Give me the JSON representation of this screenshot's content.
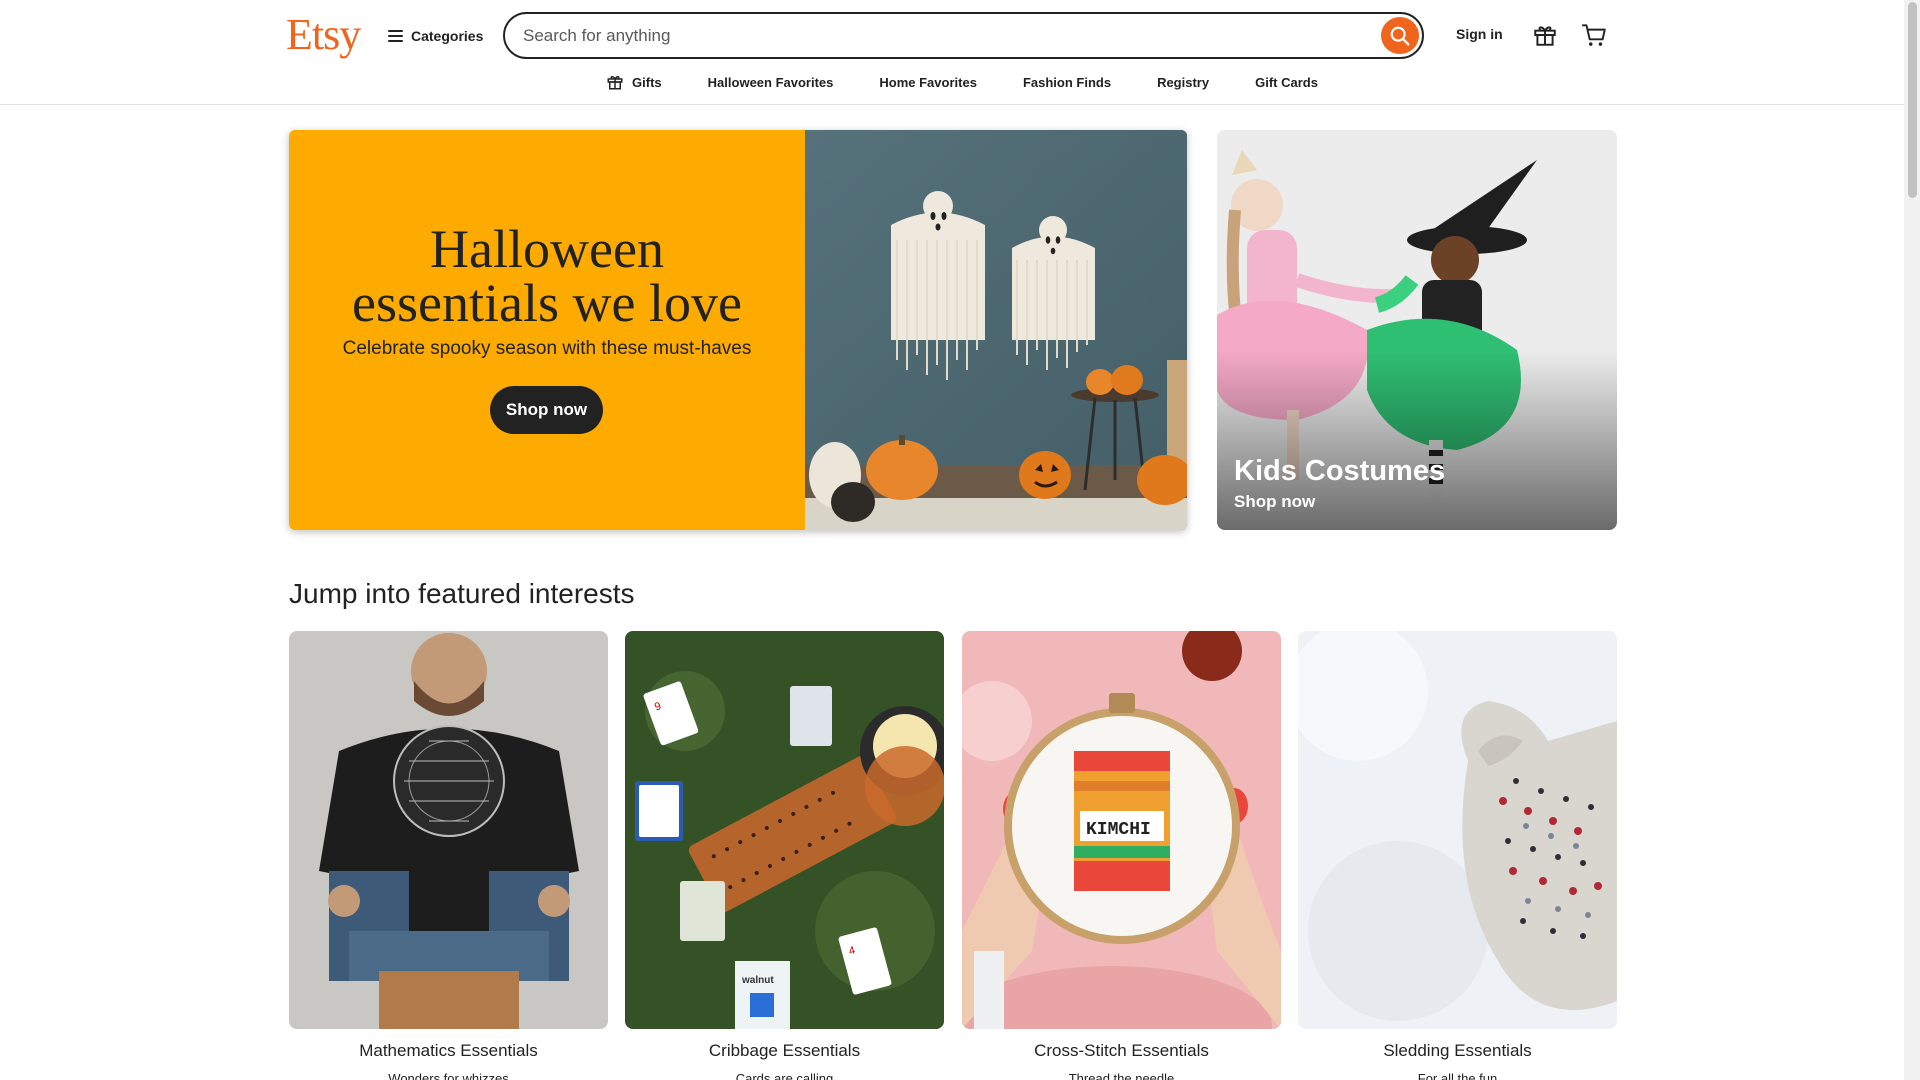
{
  "header": {
    "logo": "Etsy",
    "categories_label": "Categories",
    "search_placeholder": "Search for anything",
    "signin_label": "Sign in"
  },
  "nav": {
    "items": [
      {
        "label": "Gifts",
        "icon": "gift-icon"
      },
      {
        "label": "Halloween Favorites"
      },
      {
        "label": "Home Favorites"
      },
      {
        "label": "Fashion Finds"
      },
      {
        "label": "Registry"
      },
      {
        "label": "Gift Cards"
      }
    ]
  },
  "hero": {
    "title_line1": "Halloween",
    "title_line2": "essentials we love",
    "subtitle": "Celebrate spooky season with these must-haves",
    "button_label": "Shop now"
  },
  "side_promo": {
    "title": "Kids Costumes",
    "subtitle": "Shop now"
  },
  "featured": {
    "title": "Jump into featured interests",
    "cards": [
      {
        "title": "Mathematics Essentials",
        "subtitle": "Wonders for whizzes"
      },
      {
        "title": "Cribbage Essentials",
        "subtitle": "Cards are calling"
      },
      {
        "title": "Cross-Stitch Essentials",
        "subtitle": "Thread the needle"
      },
      {
        "title": "Sledding Essentials",
        "subtitle": "For all the fun"
      }
    ],
    "image_text": {
      "kimchi": "KIMCHI",
      "walnut": "walnut"
    }
  },
  "colors": {
    "brand": "#f1641e",
    "hero_bg": "#fdab00",
    "text": "#222222"
  }
}
